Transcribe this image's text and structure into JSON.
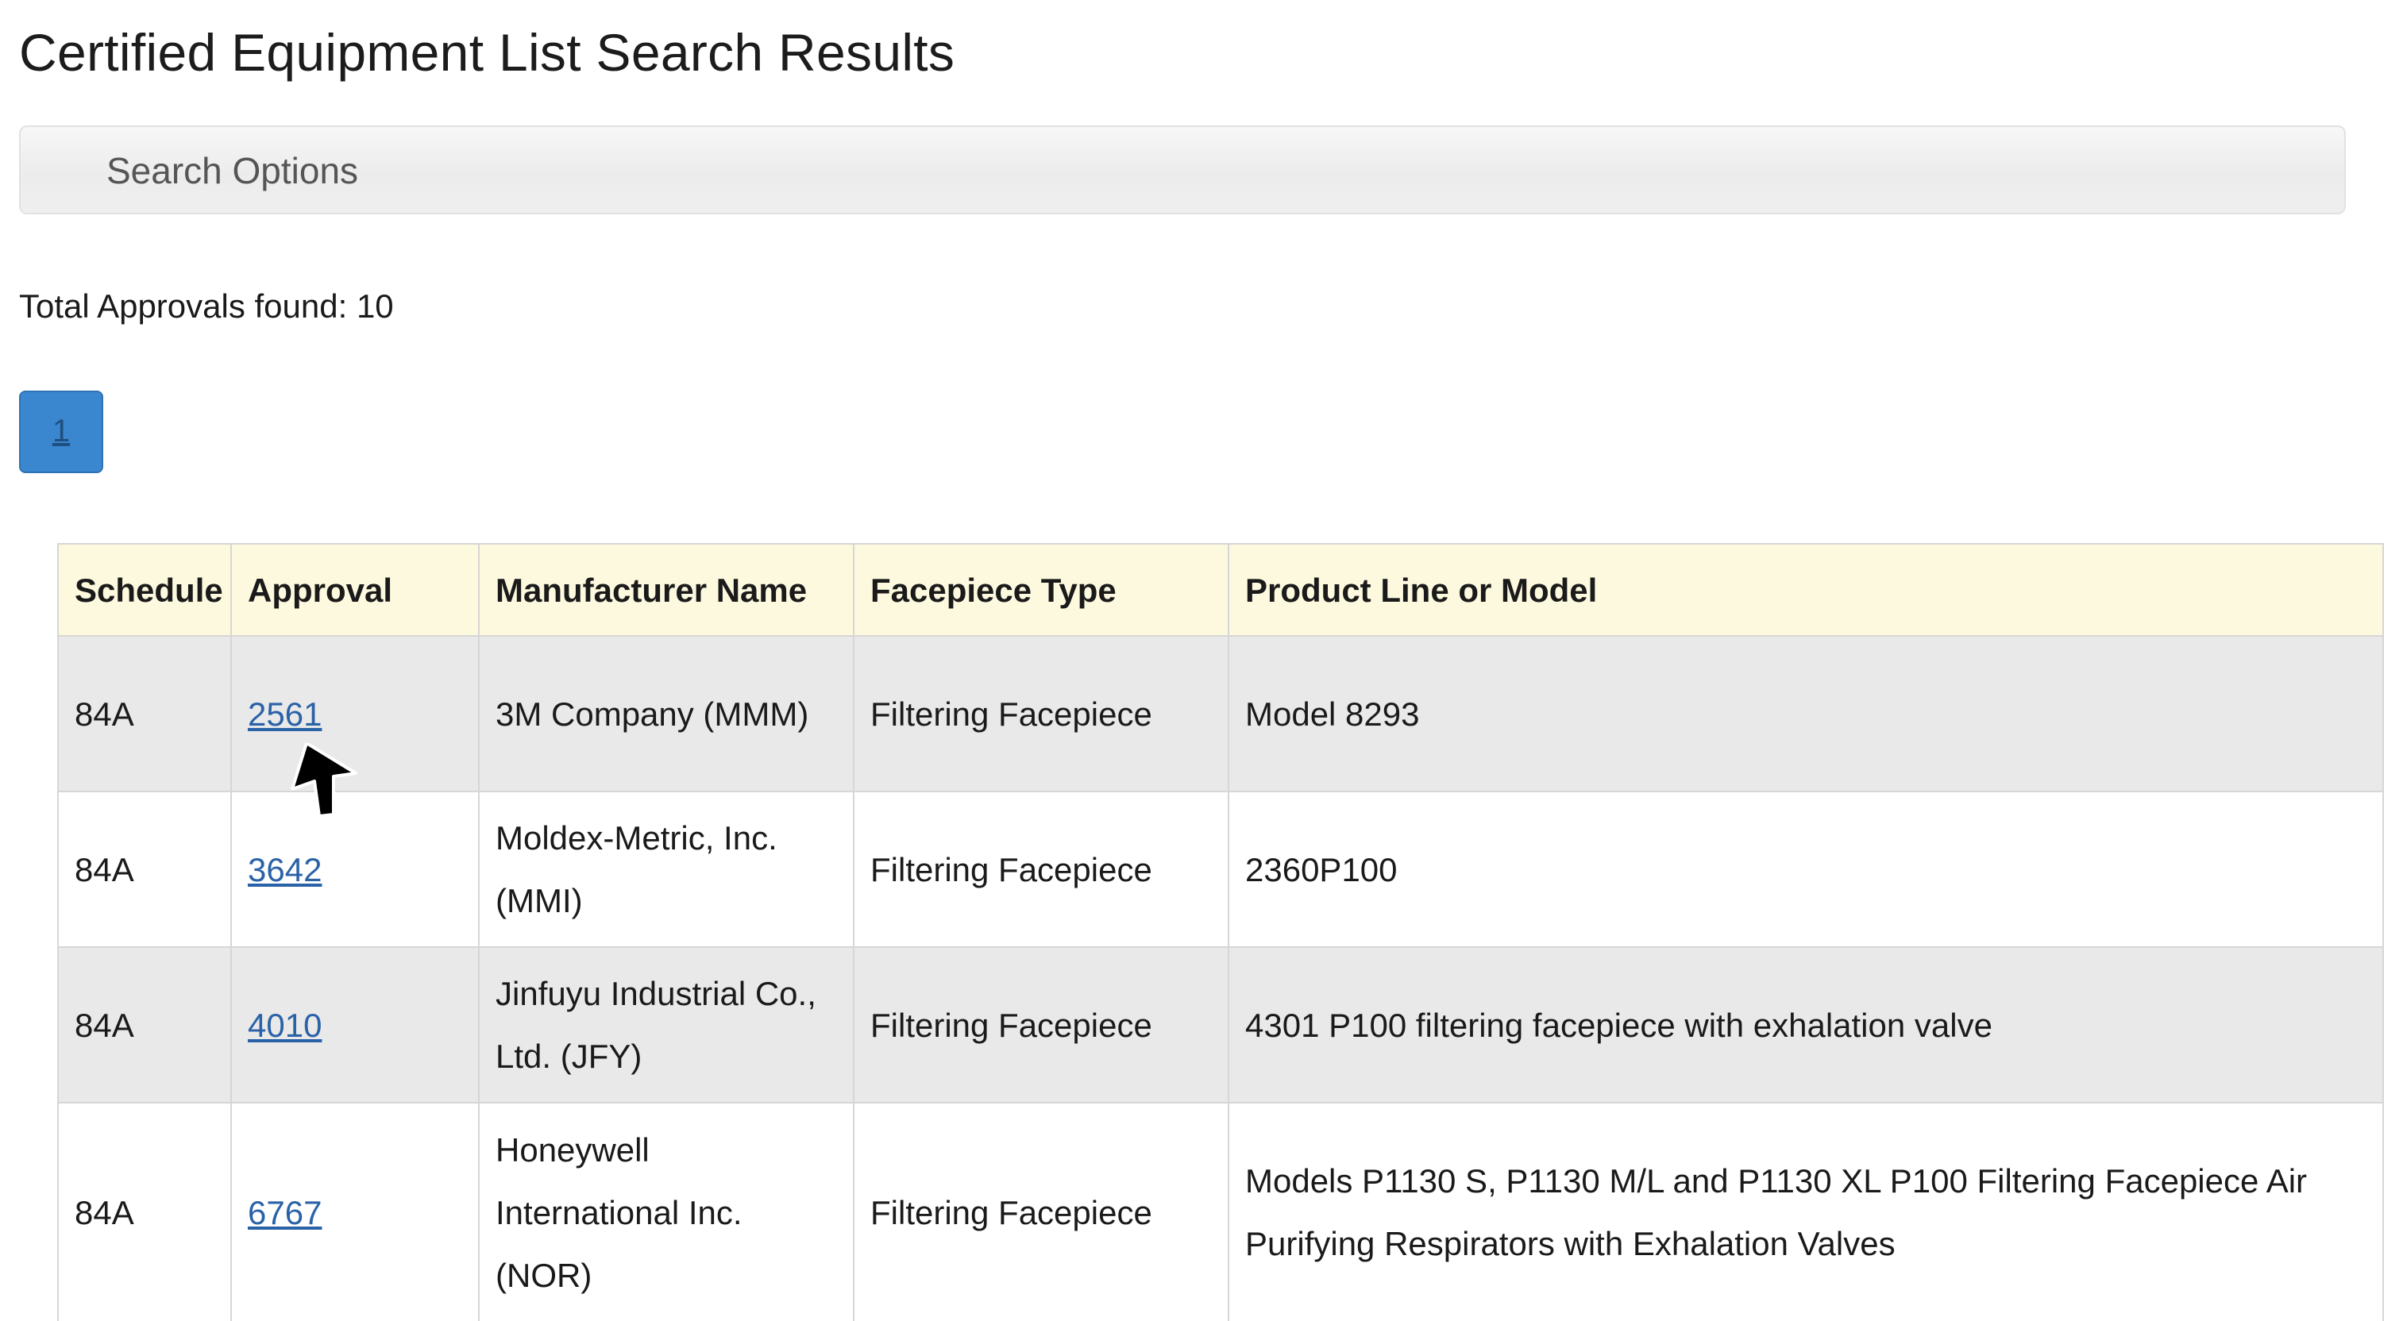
{
  "page": {
    "title": "Certified Equipment List Search Results"
  },
  "search_options": {
    "label": "Search Options"
  },
  "summary": {
    "total_approvals": "Total Approvals found: 10"
  },
  "pagination": {
    "current_page": "1"
  },
  "table": {
    "headers": [
      "Schedule",
      "Approval",
      "Manufacturer Name",
      "Facepiece Type",
      "Product Line or Model"
    ],
    "rows": [
      {
        "schedule": "84A",
        "approval": "2561",
        "manufacturer": "3M Company (MMM)",
        "facepiece": "Filtering Facepiece",
        "model": "Model 8293"
      },
      {
        "schedule": "84A",
        "approval": "3642",
        "manufacturer": "Moldex-Metric, Inc. (MMI)",
        "facepiece": "Filtering Facepiece",
        "model": "2360P100"
      },
      {
        "schedule": "84A",
        "approval": "4010",
        "manufacturer": "Jinfuyu Industrial Co., Ltd. (JFY)",
        "facepiece": "Filtering Facepiece",
        "model": "4301 P100 filtering facepiece with exhalation valve"
      },
      {
        "schedule": "84A",
        "approval": "6767",
        "manufacturer": "Honeywell International Inc. (NOR)",
        "facepiece": "Filtering Facepiece",
        "model": "Models P1130 S, P1130 M/L and P1130 XL P100 Filtering Facepiece Air Purifying Respirators with Exhalation Valves"
      }
    ]
  },
  "icons": {
    "cursor": "mouse-pointer-arrow-icon"
  },
  "colors": {
    "header_bg": "#fdf9df",
    "shaded_row": "#e9e9e9",
    "pager_bg": "#3a86cf",
    "link": "#2a62a8"
  }
}
